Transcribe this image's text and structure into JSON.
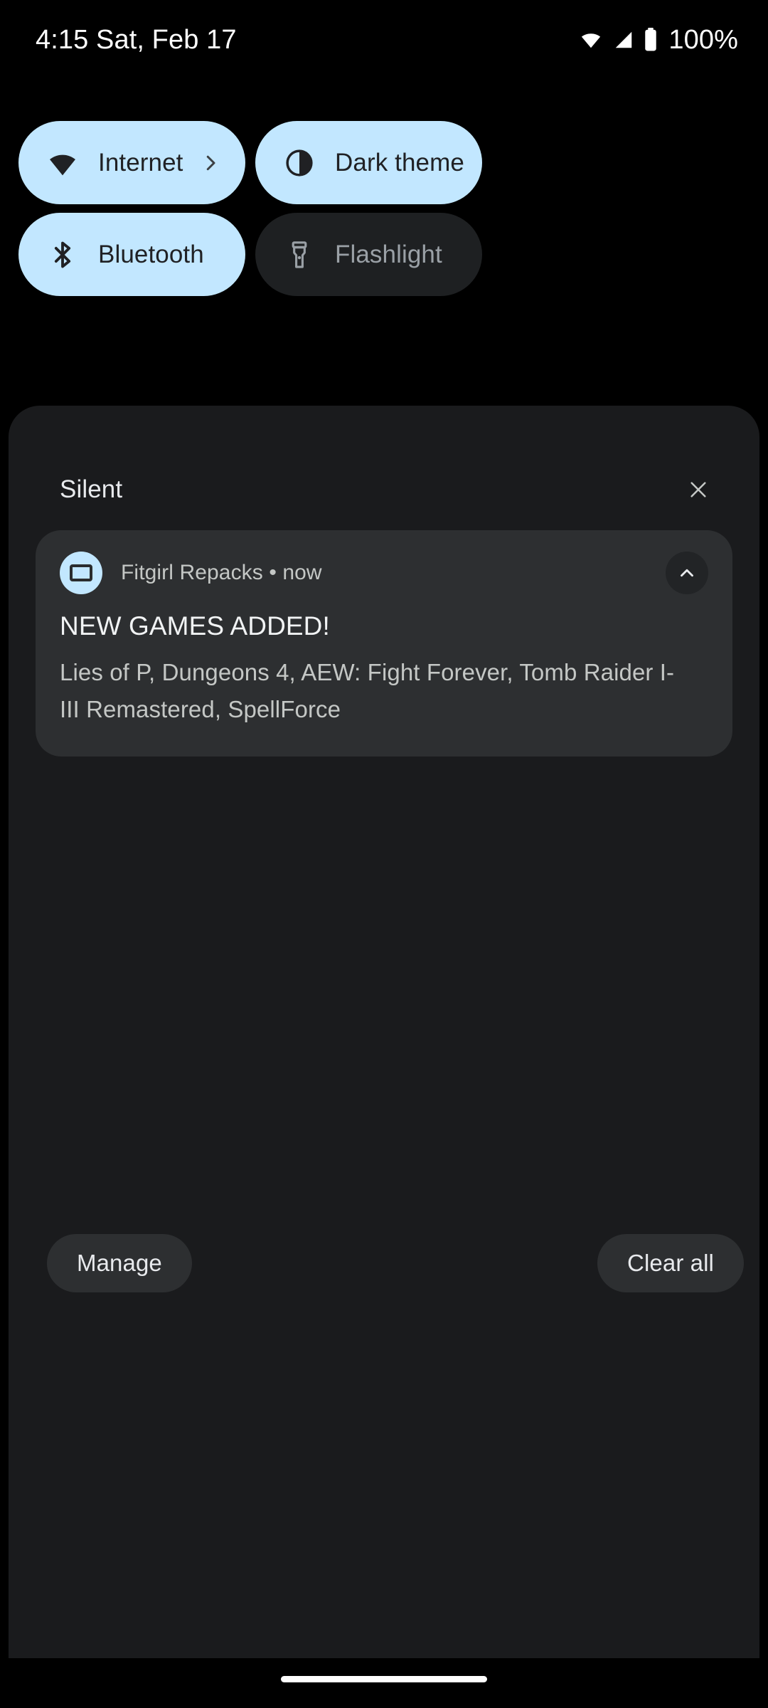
{
  "status_bar": {
    "clock": "4:15 Sat, Feb 17",
    "battery_percent": "100%",
    "icons": [
      "wifi-icon",
      "cellular-signal-icon",
      "battery-icon"
    ]
  },
  "quick_settings": {
    "tiles": [
      {
        "label": "Internet",
        "icon": "wifi-icon",
        "state": "on",
        "has_chevron": true
      },
      {
        "label": "Dark theme",
        "icon": "contrast-icon",
        "state": "on",
        "has_chevron": false
      },
      {
        "label": "Bluetooth",
        "icon": "bluetooth-icon",
        "state": "on",
        "has_chevron": false
      },
      {
        "label": "Flashlight",
        "icon": "flashlight-icon",
        "state": "off",
        "has_chevron": false
      }
    ]
  },
  "notifications": {
    "section_title": "Silent",
    "close_icon": "close-icon",
    "items": [
      {
        "app_name": "Fitgirl Repacks",
        "separator": "•",
        "time": "now",
        "meta": "Fitgirl Repacks • now",
        "title": "NEW GAMES ADDED!",
        "body": "Lies of P, Dungeons 4, AEW: Fight Forever, Tomb Raider I-III Remastered, SpellForce",
        "collapse_icon": "chevron-up-icon",
        "avatar_icon": "app-badge-icon"
      }
    ],
    "manage_label": "Manage",
    "clear_all_label": "Clear all"
  },
  "colors": {
    "background": "#000000",
    "panel": "#1a1b1d",
    "tile_on": "#c2e7ff",
    "tile_off": "#1e2022",
    "card": "#2d2f31",
    "text_primary": "#f1f3f4",
    "text_secondary": "#c4c7c5",
    "text_disabled": "#9aa0a6",
    "tile_on_text": "#202124"
  }
}
